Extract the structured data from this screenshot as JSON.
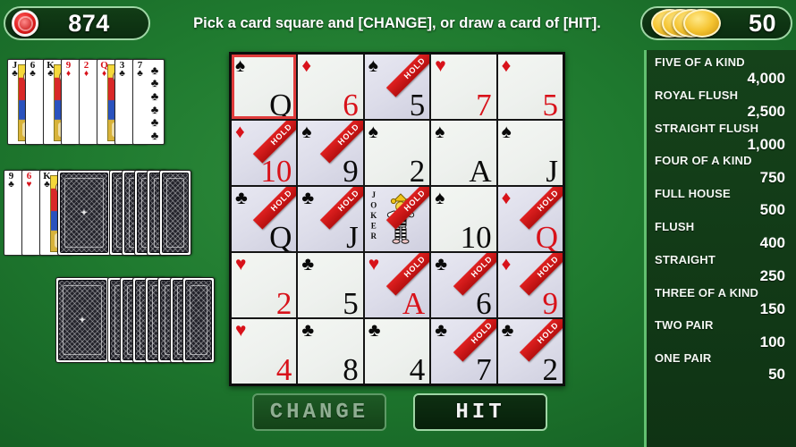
{
  "topbar": {
    "score_icon": "red-poker-chip",
    "score": "874",
    "instruction": "Pick a card square and [CHANGE], or draw a card of [HIT].",
    "chips_icon": "gold-poker-chip-stack",
    "chips": "50"
  },
  "buttons": {
    "change": "CHANGE",
    "hit": "HIT"
  },
  "payouts": [
    {
      "name": "FIVE OF A KIND",
      "value": "4,000"
    },
    {
      "name": "ROYAL FLUSH",
      "value": "2,500"
    },
    {
      "name": "STRAIGHT FLUSH",
      "value": "1,000"
    },
    {
      "name": "FOUR OF A KIND",
      "value": "750"
    },
    {
      "name": "FULL HOUSE",
      "value": "500"
    },
    {
      "name": "FLUSH",
      "value": "400"
    },
    {
      "name": "STRAIGHT",
      "value": "250"
    },
    {
      "name": "THREE OF A KIND",
      "value": "150"
    },
    {
      "name": "TWO PAIR",
      "value": "100"
    },
    {
      "name": "ONE PAIR",
      "value": "50"
    }
  ],
  "grid": {
    "rows": 5,
    "cols": 5,
    "cells": [
      {
        "rank": "Q",
        "suit": "♠",
        "color": "black",
        "hold": false,
        "selected": true
      },
      {
        "rank": "6",
        "suit": "♦",
        "color": "red",
        "hold": false,
        "selected": false
      },
      {
        "rank": "5",
        "suit": "♠",
        "color": "black",
        "hold": true,
        "selected": false
      },
      {
        "rank": "7",
        "suit": "♥",
        "color": "red",
        "hold": false,
        "selected": false
      },
      {
        "rank": "5",
        "suit": "♦",
        "color": "red",
        "hold": false,
        "selected": false
      },
      {
        "rank": "10",
        "suit": "♦",
        "color": "red",
        "hold": true,
        "selected": false
      },
      {
        "rank": "9",
        "suit": "♠",
        "color": "black",
        "hold": true,
        "selected": false
      },
      {
        "rank": "2",
        "suit": "♠",
        "color": "black",
        "hold": false,
        "selected": false
      },
      {
        "rank": "A",
        "suit": "♠",
        "color": "black",
        "hold": false,
        "selected": false
      },
      {
        "rank": "J",
        "suit": "♠",
        "color": "black",
        "hold": false,
        "selected": false
      },
      {
        "rank": "Q",
        "suit": "♣",
        "color": "black",
        "hold": true,
        "selected": false
      },
      {
        "rank": "J",
        "suit": "♣",
        "color": "black",
        "hold": true,
        "selected": false
      },
      {
        "rank": "JOKER",
        "suit": "",
        "color": "black",
        "hold": true,
        "selected": false,
        "joker": true,
        "joker_label": "JOKER"
      },
      {
        "rank": "10",
        "suit": "♠",
        "color": "black",
        "hold": false,
        "selected": false
      },
      {
        "rank": "Q",
        "suit": "♦",
        "color": "red",
        "hold": true,
        "selected": false
      },
      {
        "rank": "2",
        "suit": "♥",
        "color": "red",
        "hold": false,
        "selected": false
      },
      {
        "rank": "5",
        "suit": "♣",
        "color": "black",
        "hold": false,
        "selected": false
      },
      {
        "rank": "A",
        "suit": "♥",
        "color": "red",
        "hold": true,
        "selected": false
      },
      {
        "rank": "6",
        "suit": "♣",
        "color": "black",
        "hold": true,
        "selected": false
      },
      {
        "rank": "9",
        "suit": "♦",
        "color": "red",
        "hold": true,
        "selected": false
      },
      {
        "rank": "4",
        "suit": "♥",
        "color": "red",
        "hold": false,
        "selected": false
      },
      {
        "rank": "8",
        "suit": "♣",
        "color": "black",
        "hold": false,
        "selected": false
      },
      {
        "rank": "4",
        "suit": "♣",
        "color": "black",
        "hold": false,
        "selected": false
      },
      {
        "rank": "7",
        "suit": "♣",
        "color": "black",
        "hold": true,
        "selected": false
      },
      {
        "rank": "2",
        "suit": "♣",
        "color": "black",
        "hold": true,
        "selected": false
      }
    ],
    "hold_label": "HOLD"
  },
  "fans": {
    "top": {
      "cards": [
        {
          "rank": "J",
          "suit": "♣",
          "color": "black",
          "face": true
        },
        {
          "rank": "6",
          "suit": "♣",
          "color": "black",
          "face": false
        },
        {
          "rank": "K",
          "suit": "♣",
          "color": "black",
          "face": true
        },
        {
          "rank": "9",
          "suit": "♦",
          "color": "red",
          "face": false
        },
        {
          "rank": "2",
          "suit": "♦",
          "color": "red",
          "face": false
        },
        {
          "rank": "Q",
          "suit": "♦",
          "color": "red",
          "face": true
        },
        {
          "rank": "3",
          "suit": "♣",
          "color": "black",
          "face": false
        },
        {
          "rank": "7",
          "suit": "♣",
          "color": "black",
          "face": false
        }
      ]
    },
    "middle": {
      "cards": [
        {
          "rank": "9",
          "suit": "♣",
          "color": "black",
          "face": false
        },
        {
          "rank": "6",
          "suit": "♥",
          "color": "red",
          "face": false
        },
        {
          "rank": "K",
          "suit": "♣",
          "color": "black",
          "face": true
        }
      ],
      "backs": 6
    },
    "bottom": {
      "backs": 8
    }
  }
}
